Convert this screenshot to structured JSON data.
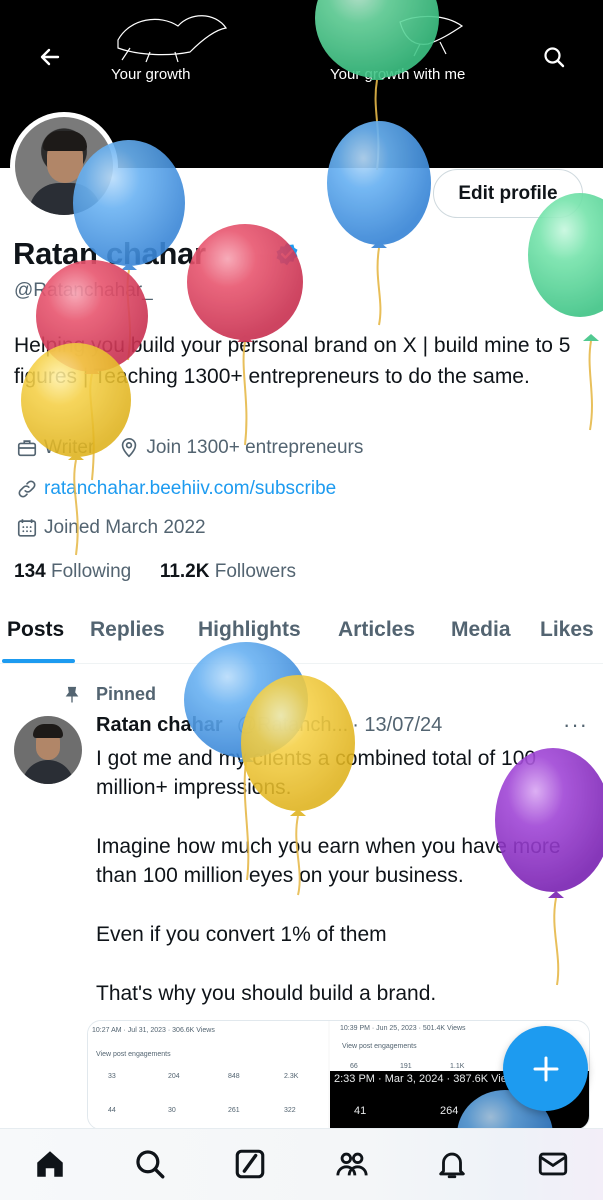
{
  "header": {
    "banner_text_left": "Your growth",
    "banner_text_right": "Your growth with me",
    "back_icon": "arrow-left-icon",
    "search_icon": "search-icon"
  },
  "profile": {
    "edit_button": "Edit profile",
    "name": "Ratan chahar",
    "handle": "@Ratanchahar_",
    "bio": "Helping you build your personal brand on X | build mine to 5 figures | Teaching 1300+ entrepreneurs to do the same.",
    "profession": "Writer",
    "location": "Join 1300+ entrepreneurs",
    "website": "ratanchahar.beehiiv.com/subscribe",
    "joined": "Joined March 2022",
    "following_count": "134",
    "following_label": "Following",
    "followers_count": "11.2K",
    "followers_label": "Followers"
  },
  "tabs": [
    {
      "label": "Posts"
    },
    {
      "label": "Replies"
    },
    {
      "label": "Highlights"
    },
    {
      "label": "Articles"
    },
    {
      "label": "Media"
    },
    {
      "label": "Likes"
    }
  ],
  "post": {
    "pinned_label": "Pinned",
    "author_name": "Ratan chahar",
    "author_handle": "@Ratanch...",
    "date": "· 13/07/24",
    "more": "···",
    "paragraphs": [
      "I got me and my clients a combined total of 100 million+ impressions.",
      "Imagine how much you earn when you have more than 100 million eyes on your business.",
      "Even if you convert 1% of them",
      "That's why you should build a brand."
    ],
    "media": {
      "left_top": "10:27 AM · Jul 31, 2023 · 306.6K Views",
      "left_engagements": "View post engagements",
      "left_stats": [
        "33",
        "204",
        "848",
        "2.3K"
      ],
      "left_stats2": [
        "44",
        "30",
        "261",
        "322"
      ],
      "right_top": "10:39 PM · Jun 25, 2023 · 501.4K Views",
      "right_engagements": "View post engagements",
      "right_stats": [
        "66",
        "191",
        "1.1K"
      ],
      "dark_top": "2:33 PM · Mar 3, 2024 · 387.6K Views",
      "dark_stats": [
        "41",
        "264"
      ]
    }
  },
  "fab": {
    "icon": "plus-icon"
  },
  "bottom_nav": [
    {
      "icon": "home-icon"
    },
    {
      "icon": "search-icon"
    },
    {
      "icon": "grok-icon"
    },
    {
      "icon": "communities-icon"
    },
    {
      "icon": "notifications-icon"
    },
    {
      "icon": "messages-icon"
    }
  ],
  "colors": {
    "accent": "#1d9bf0",
    "text": "#0f1419",
    "secondary": "#536471",
    "balloon_blue": "#5aa9ee",
    "balloon_red": "#e8506b",
    "balloon_yellow": "#f5cf44",
    "balloon_green": "#6fe0a6",
    "balloon_purple": "#9b3fd1"
  }
}
